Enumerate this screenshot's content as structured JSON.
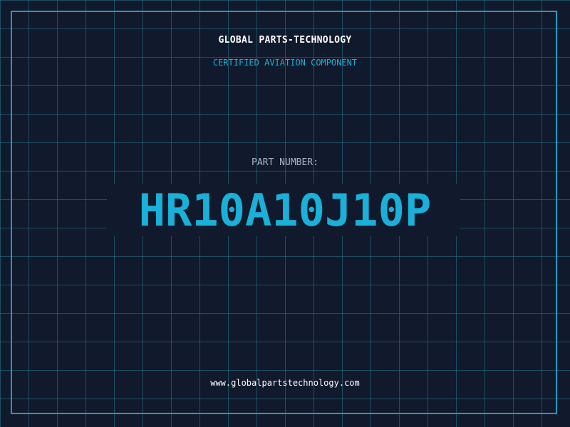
{
  "header": {
    "company": "GLOBAL PARTS-TECHNOLOGY",
    "tagline": "CERTIFIED AVIATION COMPONENT"
  },
  "part": {
    "label": "PART NUMBER:",
    "number": "HR10A10J10P"
  },
  "footer": {
    "website": "www.globalpartstechnology.com"
  },
  "colors": {
    "background": "#111a2d",
    "grid": "#26768c",
    "frame": "#1e9cc0",
    "accent": "#1ab0d8",
    "text": "#ffffff",
    "muted": "#a9b4c3"
  }
}
